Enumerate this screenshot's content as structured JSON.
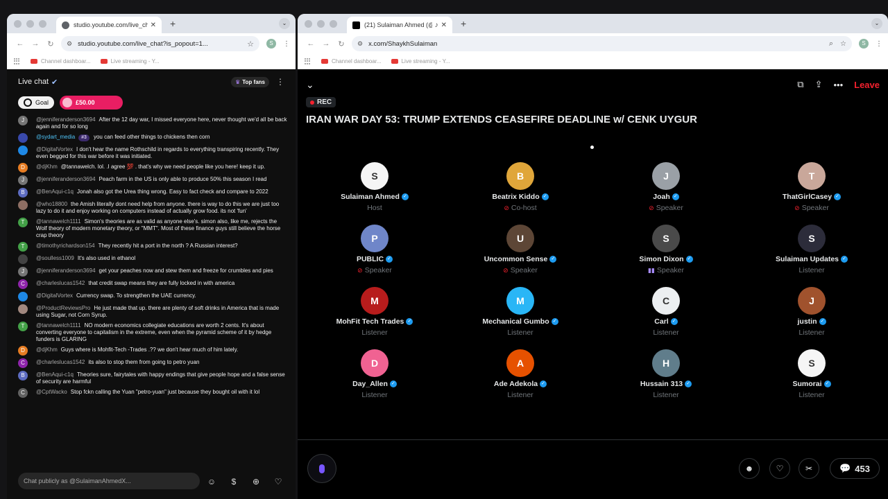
{
  "left_window": {
    "tab_title": "studio.youtube.com/live_cha",
    "url": "studio.youtube.com/live_chat?is_popout=1...",
    "bookmarks": [
      "Channel dashboar...",
      "Live streaming - Y..."
    ],
    "profile_initial": "S"
  },
  "chat": {
    "title": "Live chat",
    "top_fans": "Top fans",
    "goal_label": "Goal",
    "money_label": "£50.00",
    "input_placeholder": "Chat publicly as @SulaimanAhmedX...",
    "messages": [
      {
        "initial": "",
        "color": "#7e57c2",
        "author": "",
        "text": ""
      },
      {
        "initial": "J",
        "color": "#757575",
        "author": "@jenniferanderson3694",
        "text": "After the 12 day war, I missed everyone here, never thought we'd all be back again and for so long"
      },
      {
        "initial": "",
        "color": "#3949ab",
        "author": "@sydart_media",
        "badge": "#3",
        "member": true,
        "text": "you can feed other things to chickens then corn"
      },
      {
        "initial": "",
        "color": "#1e88e5",
        "author": "@DigitalVortex",
        "text": "I don't hear the name Rothschild in regards to everything transpiring recently. They even begged for this war before it was initiated."
      },
      {
        "initial": "D",
        "color": "#e67c22",
        "author": "@djKhm",
        "text": "@tannawelch. lol. .I agree 💯 . that's why we need people like you here! keep it up."
      },
      {
        "initial": "J",
        "color": "#757575",
        "author": "@jenniferanderson3694",
        "text": "Peach farm in the US is only able to produce 50% this season I read"
      },
      {
        "initial": "B",
        "color": "#5c6bc0",
        "author": "@BenAqui-c1q",
        "text": "Jonah also got the Urea thing wrong. Easy to fact check and compare to 2022"
      },
      {
        "initial": "",
        "color": "#8d6e63",
        "author": "@who18800",
        "text": "the Amish literally dont need help from anyone. there is way to do this we are just too lazy to do it and enjoy working on computers instead of actually grow food. its not 'fun'"
      },
      {
        "initial": "T",
        "color": "#43a047",
        "author": "@tannawelch1111",
        "text": "Simon's theories are as valid as anyone else's. simon also, like me, rejects the Wolf theory of modern monetary theory, or \"MMT\". Most of these finance guys still believe the horse crap theory"
      },
      {
        "initial": "T",
        "color": "#43a047",
        "author": "@timothyrichardson154",
        "text": "They recently hit a port in the north ? A Russian interest?"
      },
      {
        "initial": "",
        "color": "#424242",
        "author": "@soulless1009",
        "text": "It's also used in ethanol"
      },
      {
        "initial": "J",
        "color": "#757575",
        "author": "@jenniferanderson3694",
        "text": "get your peaches now and stew them and freeze for crumbles and pies"
      },
      {
        "initial": "C",
        "color": "#8e24aa",
        "author": "@charleslucas1542",
        "text": "that credit swap means they are fully locked in with america"
      },
      {
        "initial": "",
        "color": "#1e88e5",
        "author": "@DigitalVortex",
        "text": "Currency swap. To strengthen the UAE currency."
      },
      {
        "initial": "",
        "color": "#a1887f",
        "author": "@ProductReviewsPro",
        "text": "He just made that up. there are plenty of soft drinks in America that is made using Sugar, not Corn Syrup."
      },
      {
        "initial": "T",
        "color": "#43a047",
        "author": "@tannawelch1111",
        "text": "NO modern economics collegiate educations are worth 2 cents. It's about converting everyone to capitalism in the extreme, even when the pyramid scheme of it by hedge funders is GLARING"
      },
      {
        "initial": "D",
        "color": "#e67c22",
        "author": "@djKhm",
        "text": "Guys where is Mohfit-Tech -Trades .?? we don't hear much of him lately."
      },
      {
        "initial": "C",
        "color": "#8e24aa",
        "author": "@charleslucas1542",
        "text": "its also to stop them from going to petro yuan"
      },
      {
        "initial": "B",
        "color": "#5c6bc0",
        "author": "@BenAqui-c1q",
        "text": "Theories sure, fairytales with happy endings that give people hope and a false sense of security are harmful"
      },
      {
        "initial": "C",
        "color": "#616161",
        "author": "@CptWacko",
        "text": "Stop fckn calling the Yuan \"petro-yuan\" just because they bought oil with it lol"
      }
    ]
  },
  "right_window": {
    "tab_title": "(21) Sulaiman Ahmed (@S",
    "url": "x.com/ShaykhSulaiman",
    "bookmarks": [
      "Channel dashboar...",
      "Live streaming - Y..."
    ],
    "profile_initial": "S"
  },
  "space": {
    "rec_label": "REC",
    "title": "IRAN WAR DAY 53: TRUMP EXTENDS CEASEFIRE DEADLINE w/ CENK UYGUR",
    "leave_label": "Leave",
    "reply_count": "453",
    "participants": [
      {
        "name": "Sulaiman Ahmed",
        "role": "Host",
        "verified": true,
        "mic": "",
        "color": "#f5f5f5",
        "init": "S"
      },
      {
        "name": "Beatrix Kiddo",
        "role": "Co-host",
        "verified": true,
        "mic": "off",
        "color": "#e0a63a",
        "init": "B"
      },
      {
        "name": "Joah",
        "role": "Speaker",
        "verified": true,
        "mic": "off",
        "color": "#9aa0a6",
        "init": "J"
      },
      {
        "name": "ThatGirlCasey",
        "role": "Speaker",
        "verified": true,
        "mic": "off",
        "color": "#c9a79a",
        "init": "T"
      },
      {
        "name": "PUBLIC",
        "role": "Speaker",
        "verified": true,
        "mic": "off",
        "color": "#6f86c9",
        "init": "P"
      },
      {
        "name": "Uncommon Sense",
        "role": "Speaker",
        "verified": true,
        "mic": "off",
        "color": "#5d4636",
        "init": "U",
        "hand": true
      },
      {
        "name": "Simon Dixon",
        "role": "Speaker",
        "verified": true,
        "mic": "on",
        "color": "#4a4a4a",
        "init": "S"
      },
      {
        "name": "Sulaiman Updates",
        "role": "Listener",
        "verified": true,
        "mic": "",
        "color": "#2c2c3a",
        "init": "S"
      },
      {
        "name": "MohFit Tech Trades",
        "role": "Listener",
        "verified": true,
        "mic": "",
        "color": "#b71c1c",
        "init": "M"
      },
      {
        "name": "Mechanical Gumbo",
        "role": "Listener",
        "verified": true,
        "mic": "",
        "color": "#29b6f6",
        "init": "M"
      },
      {
        "name": "Carl",
        "role": "Listener",
        "verified": true,
        "mic": "",
        "color": "#eceff1",
        "init": "C"
      },
      {
        "name": "justin",
        "role": "Listener",
        "verified": true,
        "mic": "",
        "color": "#a0522d",
        "init": "J"
      },
      {
        "name": "Day_Allen",
        "role": "Listener",
        "verified": true,
        "mic": "",
        "color": "#f06292",
        "init": "D"
      },
      {
        "name": "Ade Adekola",
        "role": "Listener",
        "verified": true,
        "mic": "",
        "color": "#e65100",
        "init": "A"
      },
      {
        "name": "Hussain 313",
        "role": "Listener",
        "verified": true,
        "mic": "",
        "color": "#607d8b",
        "init": "H"
      },
      {
        "name": "Sumorai",
        "role": "Listener",
        "verified": true,
        "mic": "",
        "color": "#f5f5f5",
        "init": "S"
      }
    ]
  }
}
